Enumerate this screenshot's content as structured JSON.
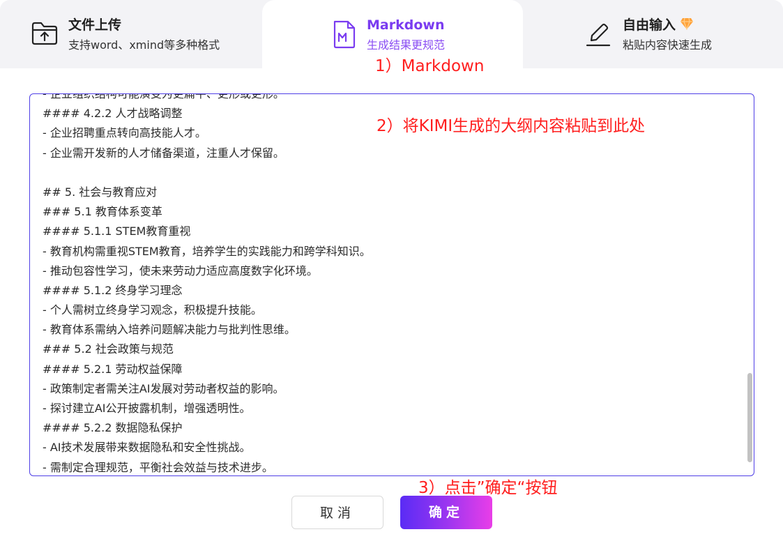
{
  "tabs": [
    {
      "title": "文件上传",
      "subtitle": "支持word、xmind等多种格式",
      "icon": "folder-upload-icon"
    },
    {
      "title": "Markdown",
      "subtitle": "生成结果更规范",
      "icon": "markdown-file-icon"
    },
    {
      "title": "自由输入",
      "subtitle": "粘贴内容快速生成",
      "icon": "pen-icon",
      "badge": "gem-icon"
    }
  ],
  "annotations": {
    "step1": "1）Markdown",
    "step2": "2）将KIMI生成的大纲内容粘贴到此处",
    "step3": "3）点击”确定“按钮"
  },
  "editor": {
    "lines": [
      "- 企业组织结构可能演变为更扁平、更形或更形。",
      "#### 4.2.2 人才战略调整",
      "- 企业招聘重点转向高技能人才。",
      "- 企业需开发新的人才储备渠道，注重人才保留。",
      "",
      "## 5. 社会与教育应对",
      "### 5.1 教育体系变革",
      "#### 5.1.1 STEM教育重视",
      "- 教育机构需重视STEM教育，培养学生的实践能力和跨学科知识。",
      "- 推动包容性学习，使未来劳动力适应高度数字化环境。",
      "#### 5.1.2 终身学习理念",
      "- 个人需树立终身学习观念，积极提升技能。",
      "- 教育体系需纳入培养问题解决能力与批判性思维。",
      "### 5.2 社会政策与规范",
      "#### 5.2.1 劳动权益保障",
      "- 政策制定者需关注AI发展对劳动者权益的影响。",
      "- 探讨建立AI公开披露机制，增强透明性。",
      "#### 5.2.2 数据隐私保护",
      "- AI技术发展带来数据隐私和安全性挑战。",
      "- 需制定合理规范，平衡社会效益与技术进步。"
    ]
  },
  "buttons": {
    "cancel": "取消",
    "confirm": "确定"
  },
  "colors": {
    "accent": "#7a3cf0",
    "annotation": "#ff1e1e",
    "editor_border": "#4f3fe6",
    "confirm_gradient_start": "#5a2cf5",
    "confirm_gradient_end": "#e93ee8"
  }
}
